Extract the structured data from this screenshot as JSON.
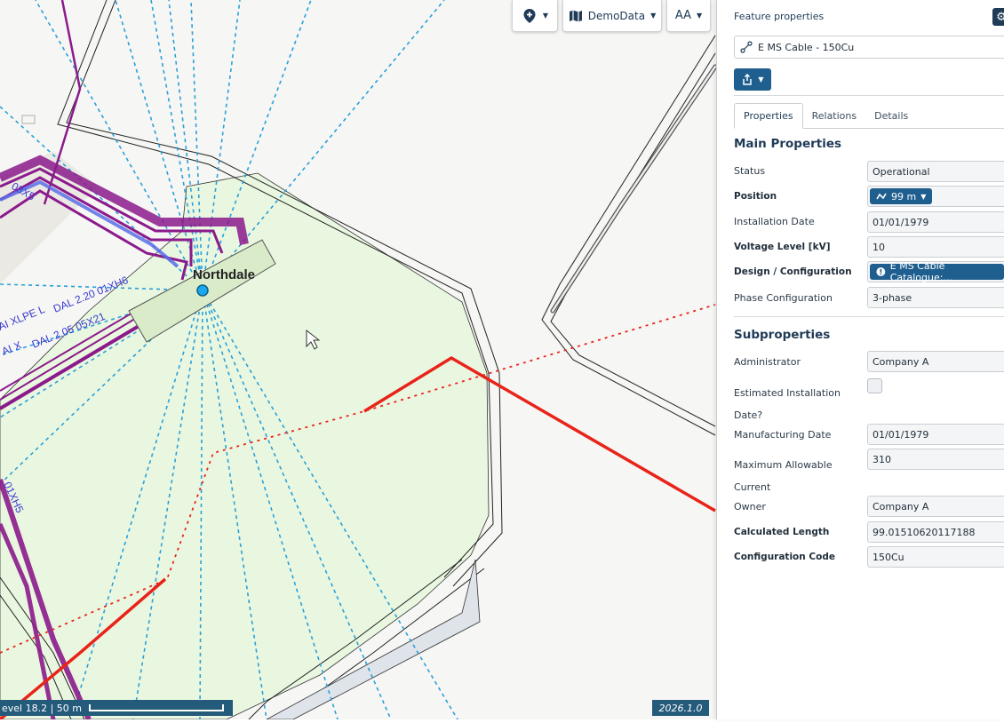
{
  "toolbar": {
    "location_button": {
      "icon": "location-plus-icon"
    },
    "basemap_button": {
      "icon": "map-icon",
      "label": "DemoData"
    },
    "text_size_button": {
      "label": "AA"
    }
  },
  "map": {
    "place_label": "Northdale",
    "cable_labels": [
      "AI XLPE L",
      "DAL 2.20 01XH6",
      "DAL 2.05 05X21",
      "AI X",
      "DAL",
      "03X5",
      "01XH5"
    ],
    "scale_text": "evel 18.2 | 50 m",
    "version": "2026.1.0"
  },
  "panel": {
    "title": "Feature properties",
    "feature_name": "E MS Cable - 150Cu",
    "tabs": [
      "Properties",
      "Relations",
      "Details"
    ],
    "active_tab": "Properties",
    "main_section": "Main Properties",
    "main_props": [
      {
        "label": "Status",
        "value": "Operational",
        "type": "text"
      },
      {
        "label": "Position",
        "value": "99 m",
        "type": "chip"
      },
      {
        "label": "Installation Date",
        "value": "01/01/1979",
        "type": "text"
      },
      {
        "label": "Voltage Level [kV]",
        "value": "10",
        "type": "text"
      },
      {
        "label": "Design / Configuration",
        "value": "E MS Cable Catalogue:...",
        "type": "chip"
      },
      {
        "label": "Phase Configuration",
        "value": "3-phase",
        "type": "text"
      }
    ],
    "sub_section": "Subproperties",
    "sub_props": [
      {
        "label": "Administrator",
        "value": "Company A",
        "type": "text"
      },
      {
        "label": "Estimated Installation Date?",
        "value": "",
        "type": "checkbox"
      },
      {
        "label": "Manufacturing Date",
        "value": "01/01/1979",
        "type": "text"
      },
      {
        "label": "Maximum Allowable Current",
        "value": "310",
        "type": "text"
      },
      {
        "label": "Owner",
        "value": "Company A",
        "type": "text"
      },
      {
        "label": "Calculated Length",
        "value": "99.01510620117188",
        "type": "text"
      },
      {
        "label": "Configuration Code",
        "value": "150Cu",
        "type": "text"
      }
    ]
  },
  "colors": {
    "accent": "#1f5f8f",
    "cable_purple": "#8b1a8b",
    "power_red": "#e8241a",
    "area_green": "#eaf7e0",
    "service_blue": "#2aa0d8"
  }
}
